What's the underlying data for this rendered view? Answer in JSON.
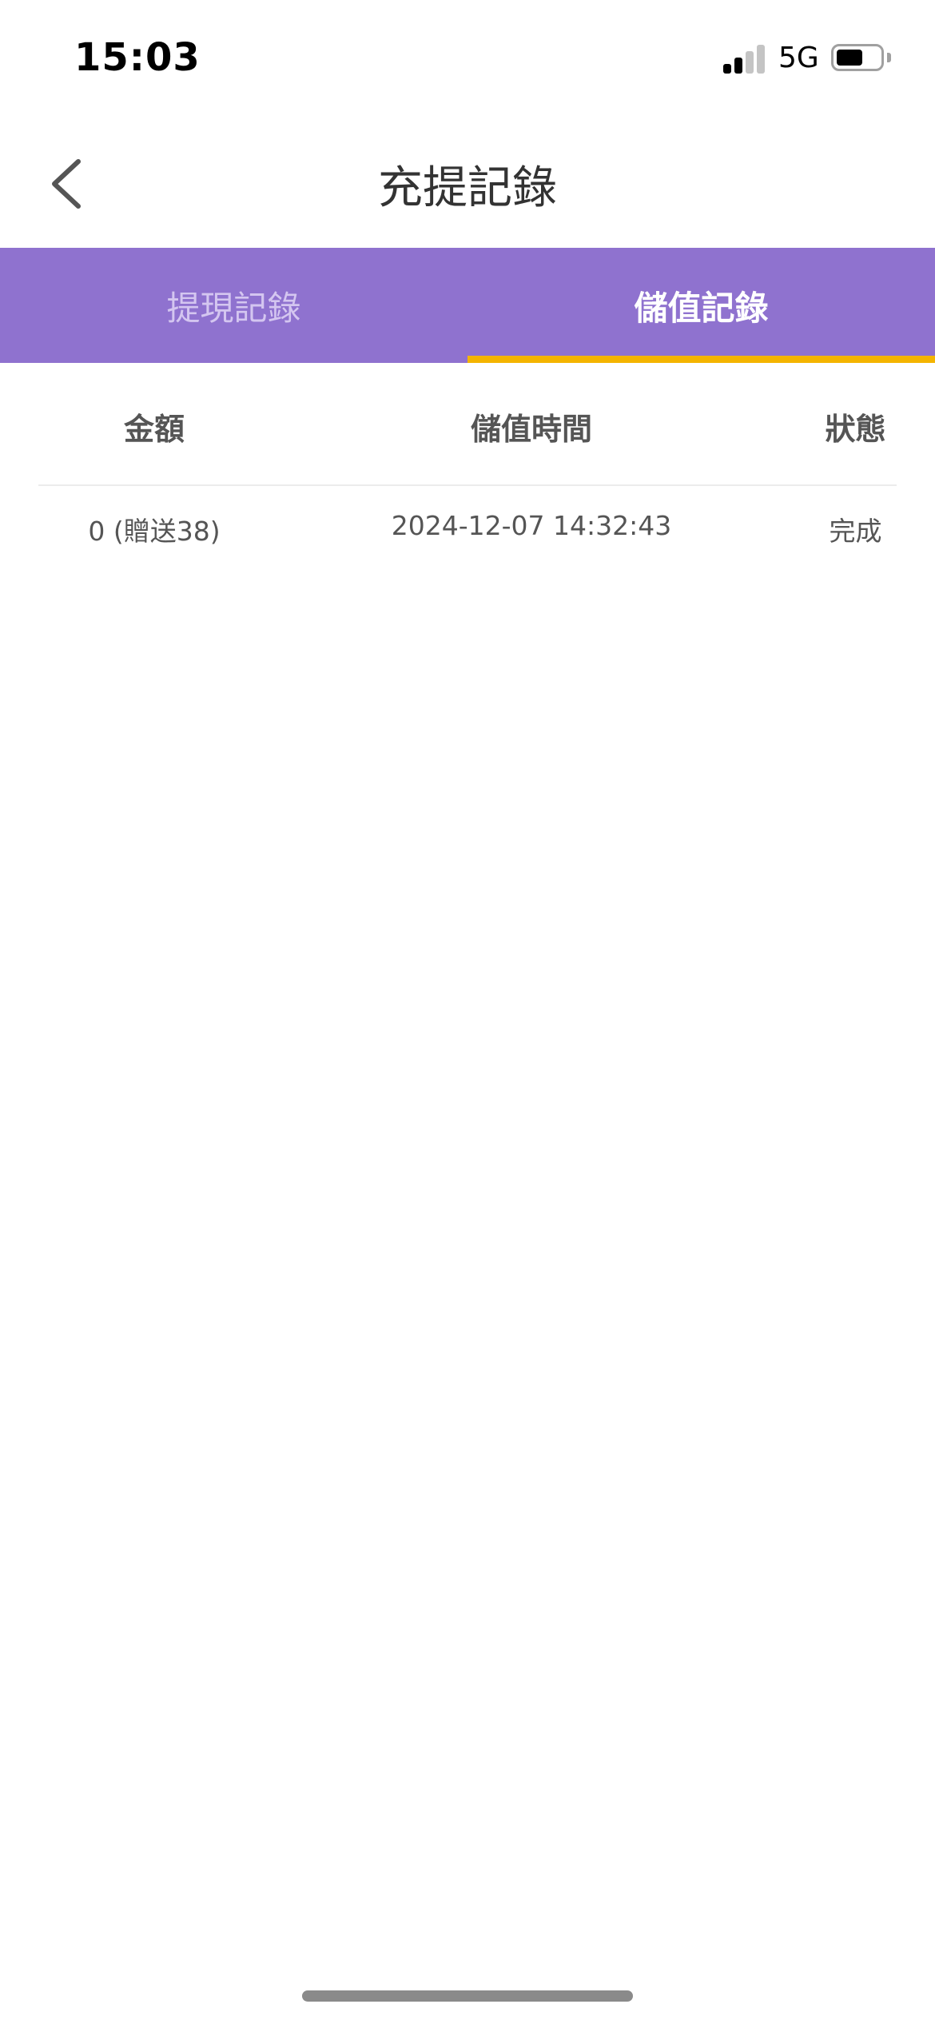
{
  "status_bar": {
    "time": "15:03",
    "network": "5G",
    "signal_bars_active": 2,
    "signal_bars_total": 4,
    "battery_level": 0.6
  },
  "nav": {
    "title": "充提記錄",
    "back_icon": "chevron-left-icon"
  },
  "tabs": [
    {
      "label": "提現記錄",
      "active": false
    },
    {
      "label": "儲值記錄",
      "active": true
    }
  ],
  "table": {
    "headers": [
      "金額",
      "儲值時間",
      "狀態"
    ],
    "rows": [
      {
        "amount": "0 (贈送38)",
        "time": "2024-12-07 14:32:43",
        "status": "完成"
      }
    ]
  },
  "colors": {
    "tab_bar_bg": "#8f72cf",
    "active_underline": "#f4b400",
    "inactive_tab_text": "#d4c6f0"
  }
}
